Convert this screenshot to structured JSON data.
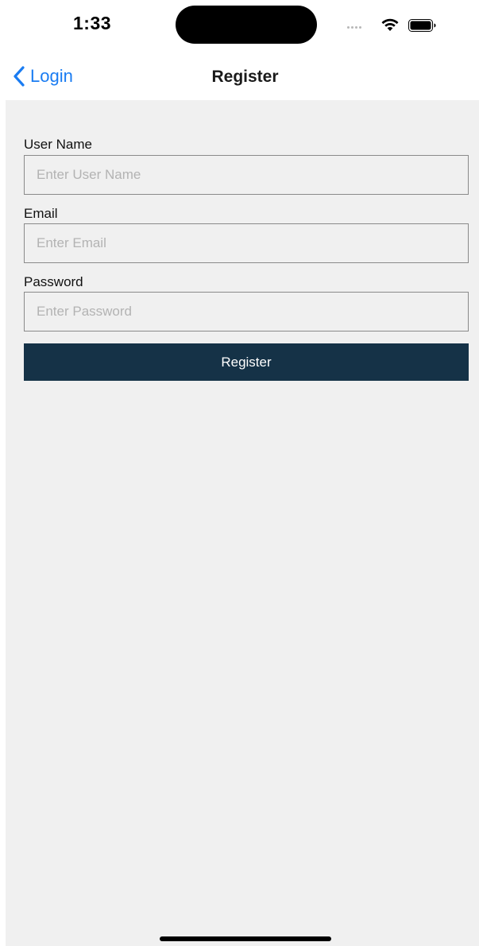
{
  "status_bar": {
    "time": "1:33",
    "icons": [
      "signal-dots-icon",
      "wifi-icon",
      "battery-icon"
    ]
  },
  "nav": {
    "back_label": "Login",
    "back_icon": "chevron-left-icon",
    "title": "Register"
  },
  "form": {
    "username": {
      "label": "User Name",
      "placeholder": "Enter User Name",
      "value": ""
    },
    "email": {
      "label": "Email",
      "placeholder": "Enter Email",
      "value": ""
    },
    "password": {
      "label": "Password",
      "placeholder": "Enter Password",
      "value": ""
    },
    "submit_label": "Register"
  },
  "colors": {
    "accent": "#1a7cf2",
    "button_bg": "#153247",
    "content_bg": "#f0f0f0"
  }
}
